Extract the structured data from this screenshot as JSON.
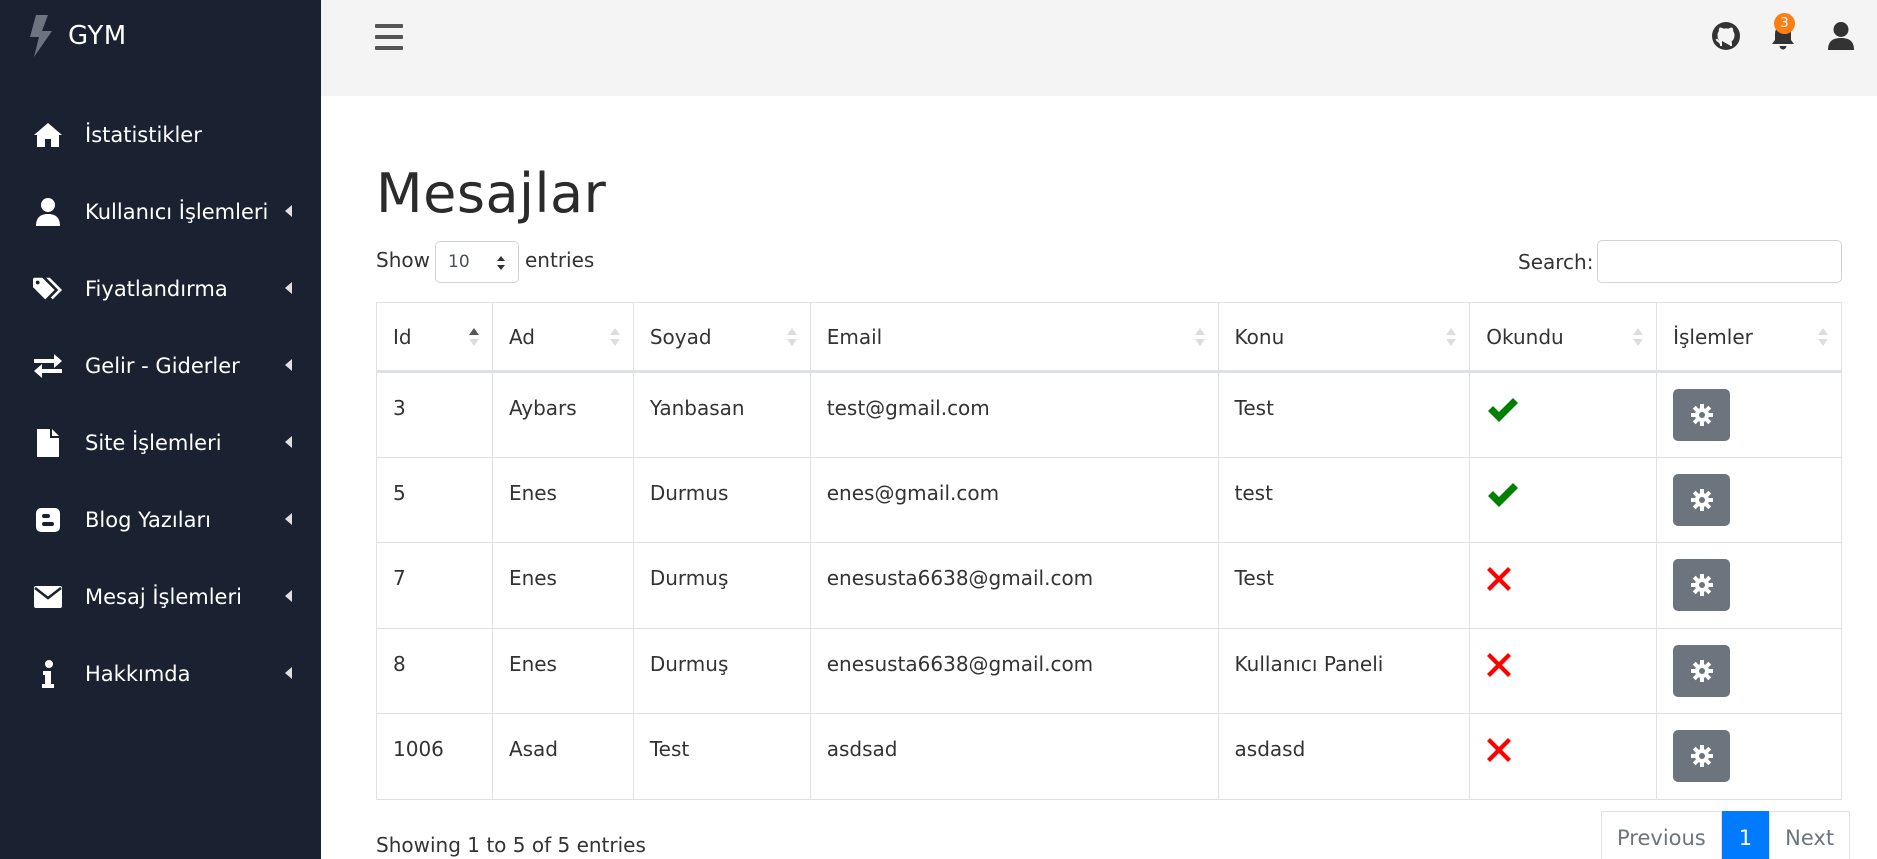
{
  "brand": {
    "name": "GYM"
  },
  "sidebar": {
    "items": [
      {
        "label": "İstatistikler",
        "icon": "home-icon",
        "has_caret": false
      },
      {
        "label": "Kullanıcı İşlemleri",
        "icon": "user-icon",
        "has_caret": true
      },
      {
        "label": "Fiyatlandırma",
        "icon": "tags-icon",
        "has_caret": true
      },
      {
        "label": "Gelir - Giderler",
        "icon": "exchange-icon",
        "has_caret": true
      },
      {
        "label": "Site İşlemleri",
        "icon": "file-icon",
        "has_caret": true
      },
      {
        "label": "Blog Yazıları",
        "icon": "blogger-icon",
        "has_caret": true
      },
      {
        "label": "Mesaj İşlemleri",
        "icon": "envelope-icon",
        "has_caret": true
      },
      {
        "label": "Hakkımda",
        "icon": "info-icon",
        "has_caret": true
      }
    ]
  },
  "topbar": {
    "notification_count": "3"
  },
  "page": {
    "title": "Mesajlar"
  },
  "controls": {
    "show_label": "Show",
    "page_length": "10",
    "entries_label": "entries",
    "search_label": "Search:",
    "search_value": ""
  },
  "table": {
    "columns": [
      "Id",
      "Ad",
      "Soyad",
      "Email",
      "Konu",
      "Okundu",
      "İşlemler"
    ],
    "sorted_column": "Id",
    "rows": [
      {
        "id": "3",
        "ad": "Aybars",
        "soyad": "Yanbasan",
        "email": "test@gmail.com",
        "konu": "Test",
        "okundu": true
      },
      {
        "id": "5",
        "ad": "Enes",
        "soyad": "Durmus",
        "email": "enes@gmail.com",
        "konu": "test",
        "okundu": true
      },
      {
        "id": "7",
        "ad": "Enes",
        "soyad": "Durmuş",
        "email": "enesusta6638@gmail.com",
        "konu": "Test",
        "okundu": false
      },
      {
        "id": "8",
        "ad": "Enes",
        "soyad": "Durmuş",
        "email": "enesusta6638@gmail.com",
        "konu": "Kullanıcı Paneli",
        "okundu": false
      },
      {
        "id": "1006",
        "ad": "Asad",
        "soyad": "Test",
        "email": "asdsad",
        "konu": "asdasd",
        "okundu": false
      }
    ]
  },
  "footer": {
    "info": "Showing 1 to 5 of 5 entries",
    "previous": "Previous",
    "current_page": "1",
    "next": "Next"
  },
  "colors": {
    "sidebar_bg": "#1a2130",
    "check": "#008000",
    "cross": "#ff0000",
    "action_button": "#6c757d",
    "active_page": "#007bff",
    "badge": "#fd7e14"
  }
}
